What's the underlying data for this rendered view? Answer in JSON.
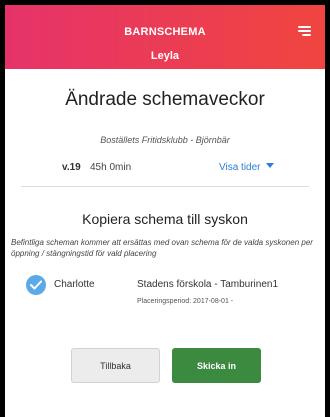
{
  "header": {
    "app_title": "BARNSCHEMA",
    "child_name": "Leyla",
    "menu_icon": "hamburger-menu-icon"
  },
  "page": {
    "title": "Ändrade schemaveckor",
    "facility": "Boställets Fritidsklubb - Björnbär"
  },
  "week": {
    "label": "v.19",
    "hours": "45h 0min",
    "show_times": "Visa tider",
    "show_times_icon": "caret-down-icon"
  },
  "copy_section": {
    "title": "Kopiera schema till syskon",
    "info": "Befintliga scheman kommer att ersättas med ovan schema för de valda syskonen per öppning / stängningstid för vald placering",
    "siblings": [
      {
        "name": "Charlotte",
        "checked": true,
        "placement": "Stadens förskola - Tamburinen1",
        "period": "Placeringsperiod: 2017-08-01 -"
      }
    ]
  },
  "actions": {
    "back_label": "Tillbaka",
    "submit_label": "Skicka in"
  },
  "colors": {
    "header_gradient_start": "#e5336a",
    "header_gradient_end": "#f0453f",
    "link": "#2a7fd4",
    "check": "#5aaae8",
    "submit": "#3b8a3f"
  }
}
